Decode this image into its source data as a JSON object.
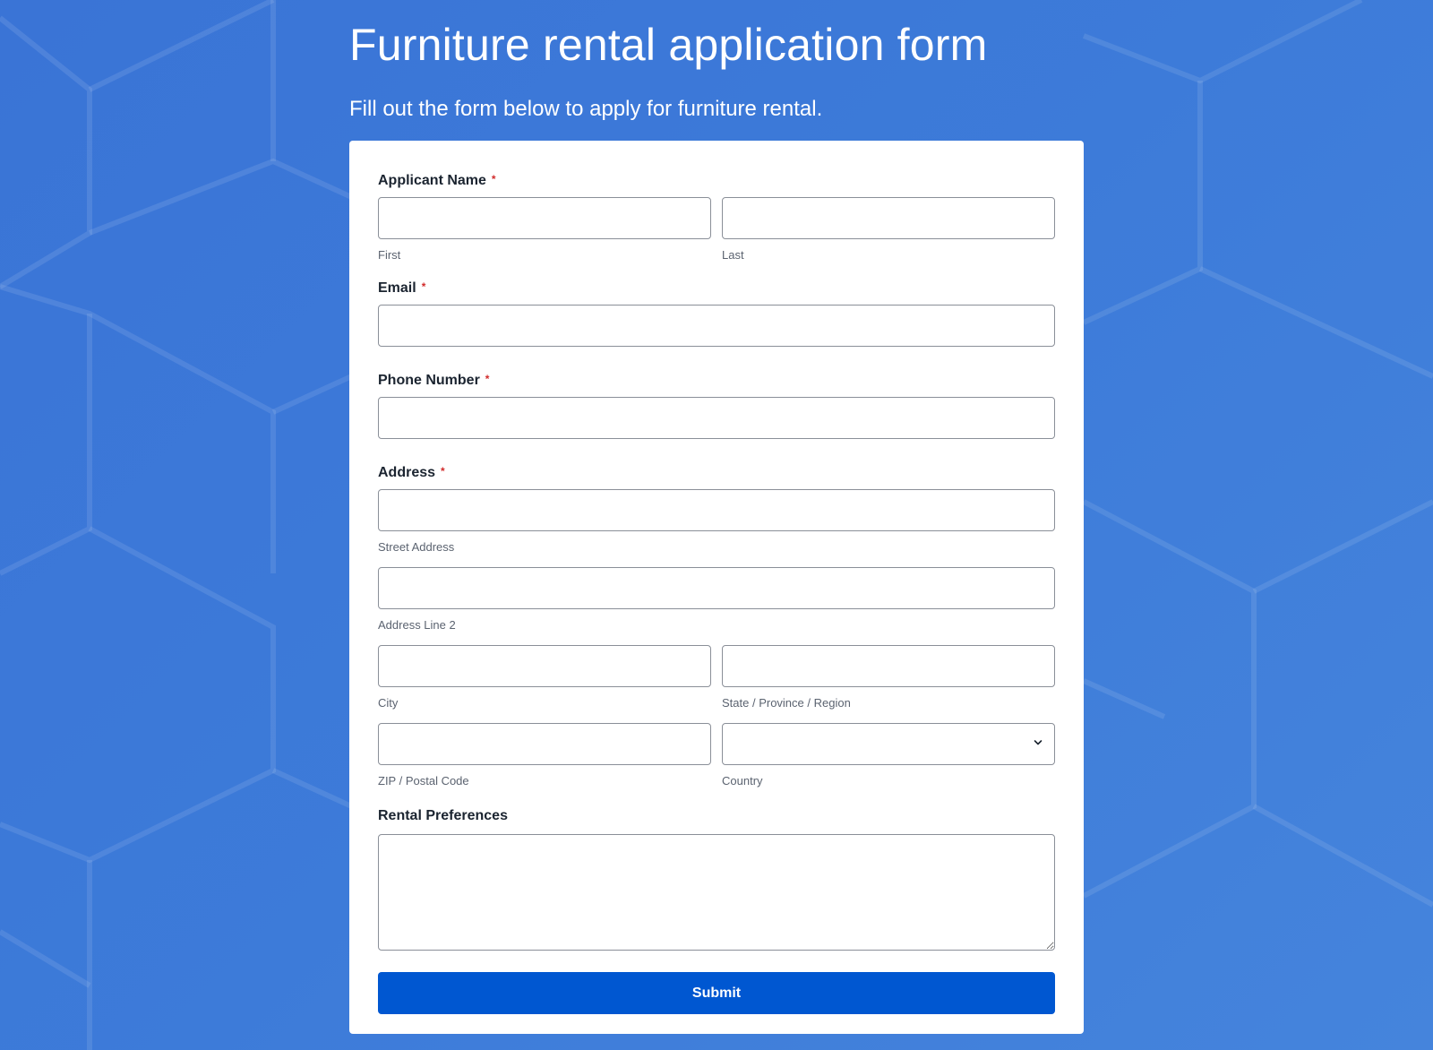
{
  "header": {
    "title": "Furniture rental application form",
    "subtitle": "Fill out the form below to apply for furniture rental."
  },
  "colors": {
    "background": "#3d7bd9",
    "card": "#ffffff",
    "submit_button": "#0057d1",
    "required_marker": "#d12b2b"
  },
  "form": {
    "required_marker": "*",
    "applicant_name": {
      "label": "Applicant Name",
      "first_label": "First",
      "first_value": "",
      "last_label": "Last",
      "last_value": ""
    },
    "email": {
      "label": "Email",
      "value": ""
    },
    "phone": {
      "label": "Phone Number",
      "value": ""
    },
    "address": {
      "label": "Address",
      "street_label": "Street Address",
      "street_value": "",
      "line2_label": "Address Line 2",
      "line2_value": "",
      "city_label": "City",
      "city_value": "",
      "state_label": "State / Province / Region",
      "state_value": "",
      "zip_label": "ZIP / Postal Code",
      "zip_value": "",
      "country_label": "Country",
      "country_value": "",
      "country_icon": "chevron-down-icon"
    },
    "rental_preferences": {
      "label": "Rental Preferences",
      "value": ""
    },
    "submit_label": "Submit"
  }
}
